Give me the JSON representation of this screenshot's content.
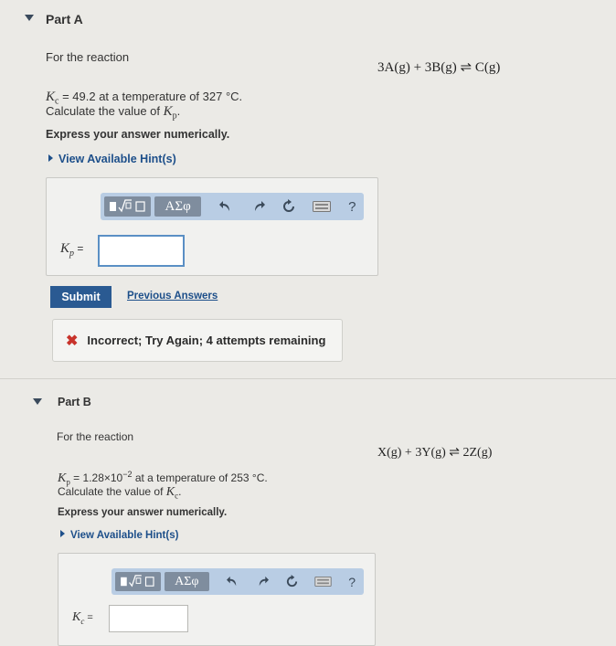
{
  "partA": {
    "title": "Part A",
    "intro": "For the reaction",
    "equation": "3A(g) + 3B(g) ⇌ C(g)",
    "given_symbol": "K",
    "given_sub": "c",
    "given_text": " = 49.2 at a temperature of 327 °C.",
    "calc_text": "Calculate the value of ",
    "calc_symbol": "K",
    "calc_sub": "p",
    "calc_end": ".",
    "instruction": "Express your answer numerically.",
    "hint": "View Available Hint(s)",
    "answer_symbol": "K",
    "answer_sub": "p",
    "answer_eq": " =",
    "submit": "Submit",
    "previous": "Previous Answers",
    "feedback": "Incorrect; Try Again; 4 attempts remaining"
  },
  "partB": {
    "title": "Part B",
    "intro": "For the reaction",
    "equation": "X(g) + 3Y(g) ⇌ 2Z(g)",
    "given_symbol": "K",
    "given_sub": "p",
    "given_pre": " = 1.28×10",
    "given_exp": "−2",
    "given_text": " at a temperature of 253 °C.",
    "calc_text": "Calculate the value of ",
    "calc_symbol": "K",
    "calc_sub": "c",
    "calc_end": ".",
    "instruction": "Express your answer numerically.",
    "hint": "View Available Hint(s)",
    "answer_symbol": "K",
    "answer_sub": "c",
    "answer_eq": " ="
  },
  "toolbar": {
    "greek_label": "ΑΣφ",
    "help_label": "?"
  }
}
